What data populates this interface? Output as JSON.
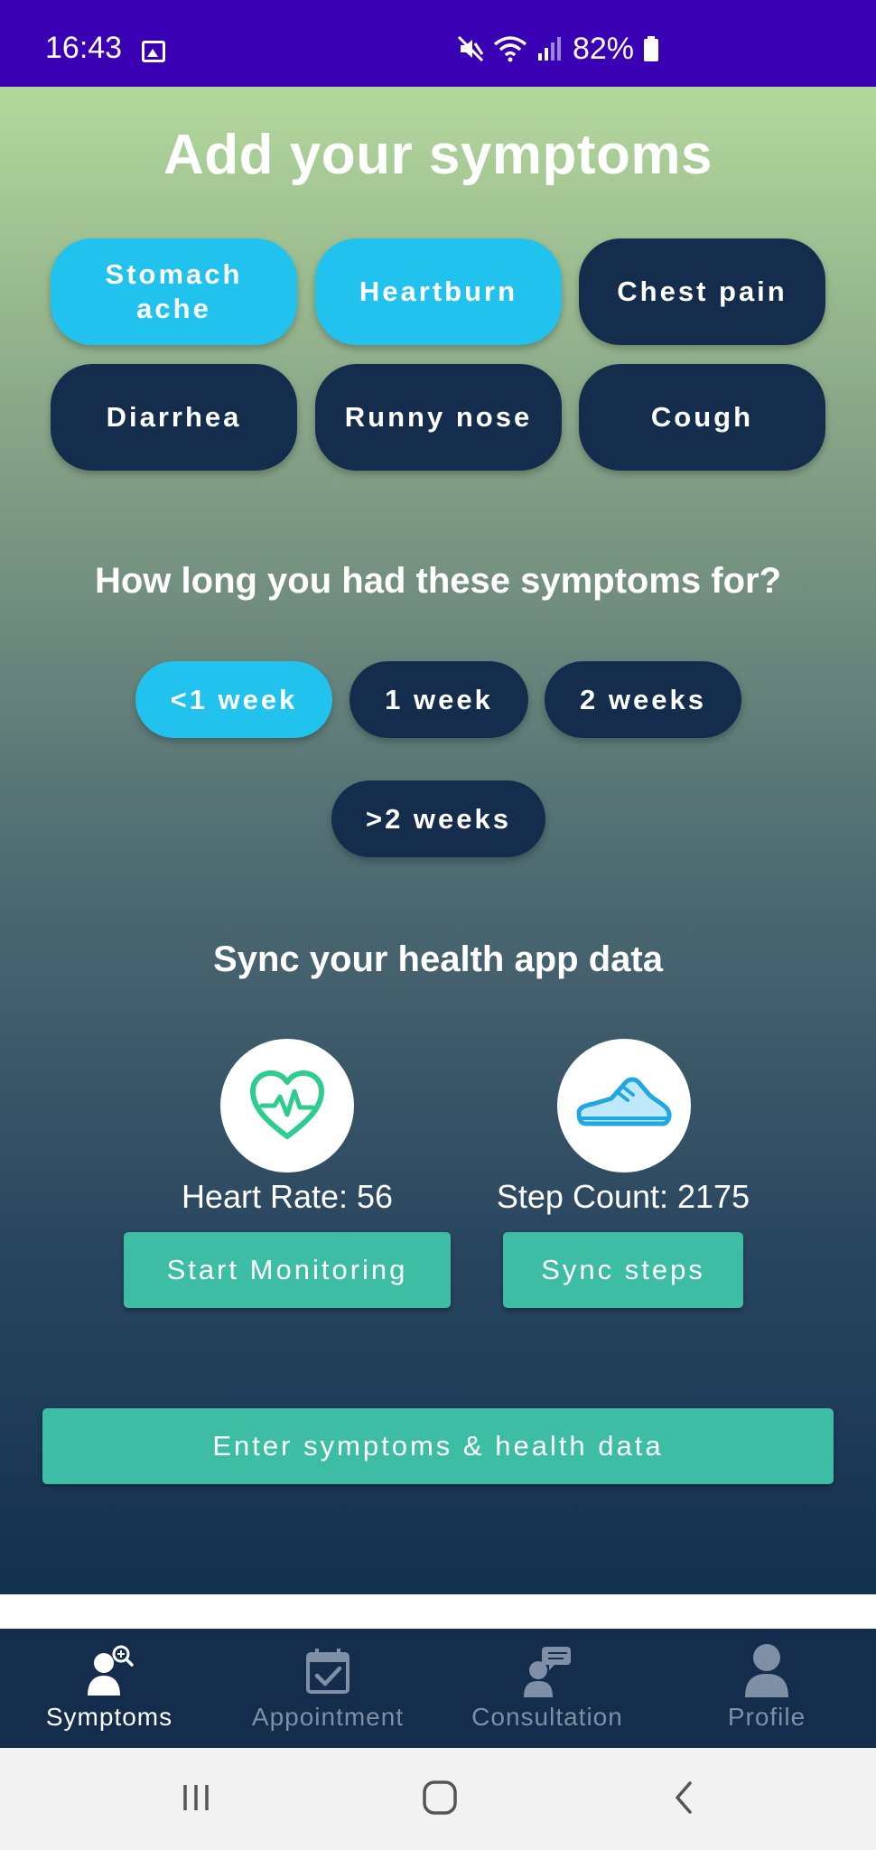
{
  "status_bar": {
    "time": "16:43",
    "battery": "82%"
  },
  "title": "Add your symptoms",
  "symptoms": [
    {
      "label": "Stomach ache",
      "selected": true
    },
    {
      "label": "Heartburn",
      "selected": true
    },
    {
      "label": "Chest pain",
      "selected": false
    },
    {
      "label": "Diarrhea",
      "selected": false
    },
    {
      "label": "Runny nose",
      "selected": false
    },
    {
      "label": "Cough",
      "selected": false
    }
  ],
  "duration": {
    "question": "How long you had these symptoms for?",
    "options": [
      {
        "label": "<1 week",
        "selected": true
      },
      {
        "label": "1 week",
        "selected": false
      },
      {
        "label": "2 weeks",
        "selected": false
      },
      {
        "label": ">2 weeks",
        "selected": false
      }
    ]
  },
  "sync": {
    "title": "Sync your health app data",
    "heart_rate_label": "Heart Rate: 56",
    "step_count_label": "Step Count: 2175",
    "start_monitoring": "Start Monitoring",
    "sync_steps": "Sync steps"
  },
  "submit_label": "Enter symptoms & health data",
  "nav": [
    {
      "label": "Symptoms",
      "icon": "symptoms-icon",
      "active": true
    },
    {
      "label": "Appointment",
      "icon": "calendar-check-icon",
      "active": false
    },
    {
      "label": "Consultation",
      "icon": "consultation-icon",
      "active": false
    },
    {
      "label": "Profile",
      "icon": "profile-icon",
      "active": false
    }
  ],
  "colors": {
    "status_bar": "#3a00b4",
    "chip_selected": "#21c2ee",
    "chip_unselected": "#142d4d",
    "action_button": "#3dbea4",
    "heart_icon": "#2ecc8f",
    "shoe_icon": "#21a8e0",
    "nav_background": "#142d4d"
  }
}
